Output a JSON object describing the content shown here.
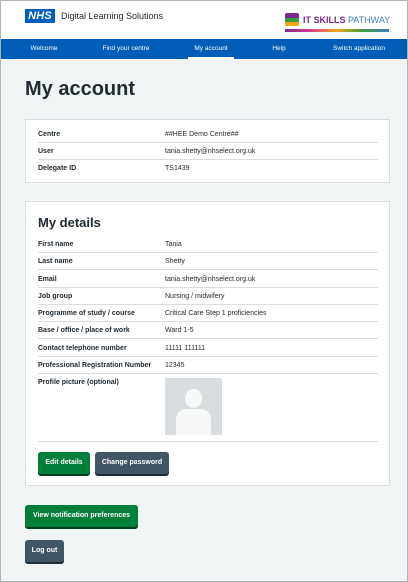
{
  "header": {
    "nhs_logo": "NHS",
    "service_name": "Digital Learning Solutions",
    "partner_logo": {
      "strong": "IT SKILLS",
      "rest": " PATHWAY",
      "icon": "it-skills-pathway-logo-icon"
    }
  },
  "nav": {
    "items": [
      {
        "label": "Welcome"
      },
      {
        "label": "Find your centre"
      },
      {
        "label": "My account",
        "active": true
      },
      {
        "label": "Help"
      },
      {
        "label": "Switch application"
      }
    ]
  },
  "page": {
    "title": "My account"
  },
  "account_summary": {
    "rows": [
      {
        "key": "Centre",
        "value": "##HEE Demo Centre##"
      },
      {
        "key": "User",
        "value": "tania.shetty@nhselect.org.uk"
      },
      {
        "key": "Delegate ID",
        "value": "TS1439"
      }
    ]
  },
  "my_details": {
    "title": "My details",
    "rows": [
      {
        "key": "First name",
        "value": "Tania"
      },
      {
        "key": "Last name",
        "value": "Shetty"
      },
      {
        "key": "Email",
        "value": "tania.shetty@nhselect.org.uk"
      },
      {
        "key": "Job group",
        "value": "Nursing / midwifery"
      },
      {
        "key": "Programme of study / course",
        "value": "Critical Care Step 1 proficiencies"
      },
      {
        "key": "Base / office / place of work",
        "value": "Ward 1-5"
      },
      {
        "key": "Contact telephone number",
        "value": "11111 111111"
      },
      {
        "key": "Professional Registration Number",
        "value": "12345"
      }
    ],
    "profile_picture_label": "Profile picture (optional)",
    "edit_button": "Edit details",
    "change_password_button": "Change password"
  },
  "actions": {
    "notification_button": "View notification preferences",
    "logout_button": "Log out"
  },
  "colors": {
    "nhs_blue": "#005eb8",
    "button_green": "#007f3b",
    "button_grey": "#425563",
    "page_background": "#f0f4f5"
  }
}
